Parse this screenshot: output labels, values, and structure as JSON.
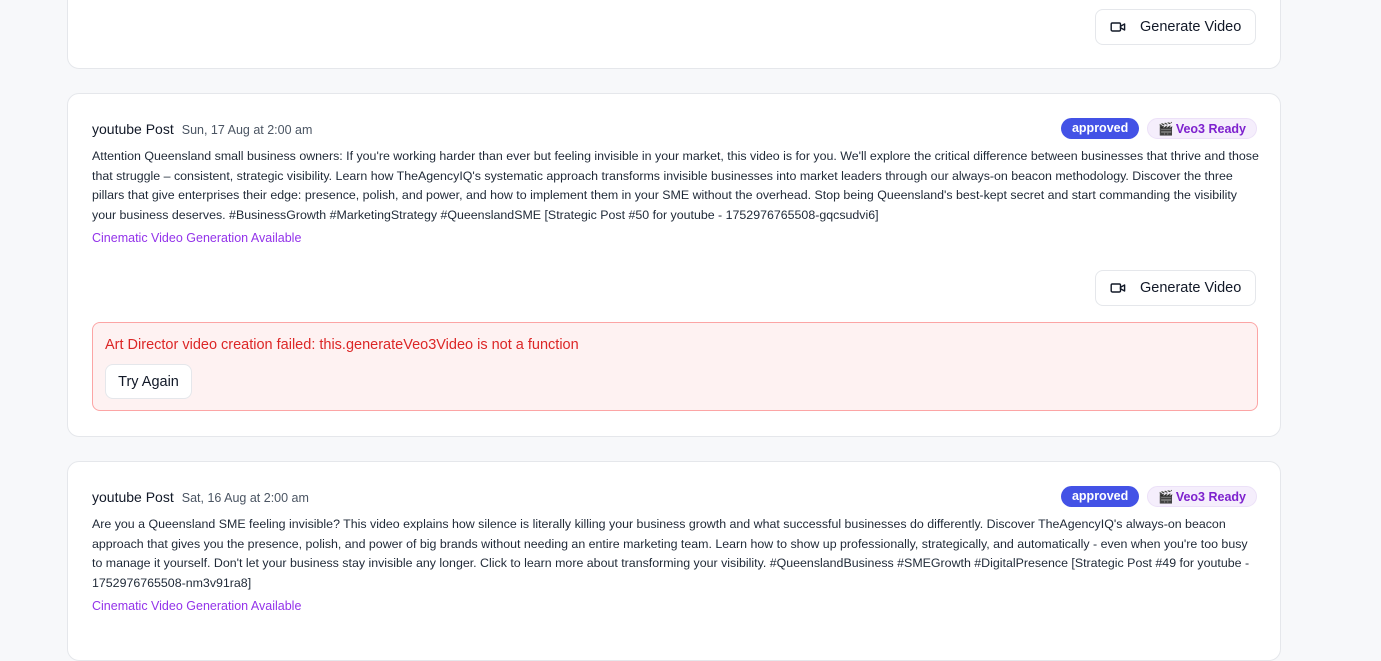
{
  "generate_video_label": "Generate Video",
  "posts": [
    {
      "title": "youtube Post",
      "date": "Sun, 17 Aug at 2:00 am",
      "status": "approved",
      "veo_clap": "🎬",
      "veo_label": "Veo3 Ready",
      "body": "Attention Queensland small business owners: If you're working harder than ever but feeling invisible in your market, this video is for you. We'll explore the critical difference between businesses that thrive and those that struggle – consistent, strategic visibility. Learn how TheAgencyIQ's systematic approach transforms invisible businesses into market leaders through our always-on beacon methodology. Discover the three pillars that give enterprises their edge: presence, polish, and power, and how to implement them in your SME without the overhead. Stop being Queensland's best-kept secret and start commanding the visibility your business deserves. #BusinessGrowth #MarketingStrategy #QueenslandSME [Strategic Post #50 for youtube - 1752976765508-gqcsudvi6]",
      "cinematic_link": "Cinematic Video Generation Available",
      "error_message": "Art Director video creation failed: this.generateVeo3Video is not a function",
      "try_again_label": "Try Again"
    },
    {
      "title": "youtube Post",
      "date": "Sat, 16 Aug at 2:00 am",
      "status": "approved",
      "veo_clap": "🎬",
      "veo_label": "Veo3 Ready",
      "body": "Are you a Queensland SME feeling invisible? This video explains how silence is literally killing your business growth and what successful businesses do differently. Discover TheAgencyIQ's always-on beacon approach that gives you the presence, polish, and power of big brands without needing an entire marketing team. Learn how to show up professionally, strategically, and automatically - even when you're too busy to manage it yourself. Don't let your business stay invisible any longer. Click to learn more about transforming your visibility. #QueenslandBusiness #SMEGrowth #DigitalPresence [Strategic Post #49 for youtube - 1752976765508-nm3v91ra8]",
      "cinematic_link": "Cinematic Video Generation Available"
    }
  ],
  "colors": {
    "approved_badge": "#4352e6",
    "veo_badge_text": "#7e22ce",
    "link": "#9333ea",
    "error_text": "#dc2626",
    "error_bg": "#fef2f2"
  },
  "icons": {
    "generate_video": "video-camera-icon"
  }
}
